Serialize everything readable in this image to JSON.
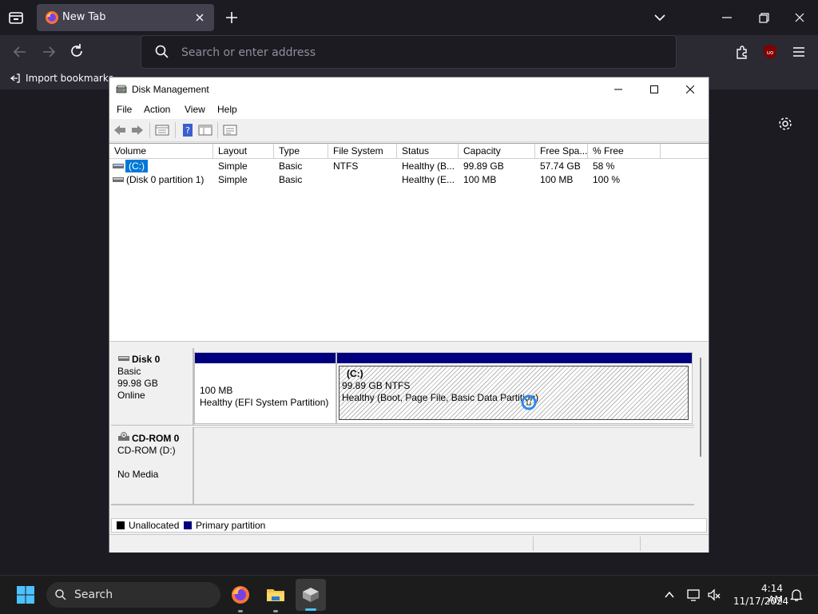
{
  "browser": {
    "tab_title": "New Tab",
    "url_placeholder": "Search or enter address",
    "bookmark_label": "Import bookmarks..."
  },
  "dm": {
    "title": "Disk Management",
    "menu": [
      "File",
      "Action",
      "View",
      "Help"
    ],
    "columns": [
      "Volume",
      "Layout",
      "Type",
      "File System",
      "Status",
      "Capacity",
      "Free Spa...",
      "% Free"
    ],
    "volumes": [
      {
        "volume": "(C:)",
        "layout": "Simple",
        "type": "Basic",
        "fs": "NTFS",
        "status": "Healthy (B...",
        "capacity": "99.89 GB",
        "free": "57.74 GB",
        "pct": "58 %"
      },
      {
        "volume": "(Disk 0 partition 1)",
        "layout": "Simple",
        "type": "Basic",
        "fs": "",
        "status": "Healthy (E...",
        "capacity": "100 MB",
        "free": "100 MB",
        "pct": "100 %"
      }
    ],
    "disks": [
      {
        "name": "Disk 0",
        "kind": "Basic",
        "size": "99.98 GB",
        "state": "Online",
        "partitions": [
          {
            "label": "",
            "size": "100 MB",
            "status": "Healthy (EFI System Partition)"
          },
          {
            "label": "(C:)",
            "size": "99.89 GB NTFS",
            "status": "Healthy (Boot, Page File, Basic Data Partition)"
          }
        ]
      },
      {
        "name": "CD-ROM 0",
        "kind": "CD-ROM (D:)",
        "size": "",
        "state": "No Media"
      }
    ],
    "legend": [
      "Unallocated",
      "Primary partition"
    ],
    "colors": {
      "primary": "#00007f",
      "unallocated": "#000000",
      "selection": "#0078d7"
    }
  },
  "taskbar": {
    "search_label": "Search",
    "time": "4:14 AM",
    "date": "11/17/2024"
  }
}
